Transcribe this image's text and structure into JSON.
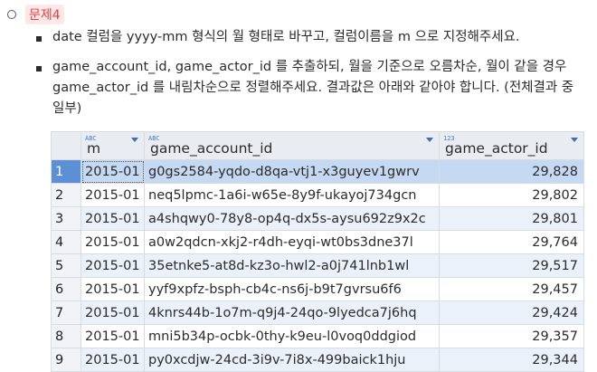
{
  "heading": {
    "badge": "문제4"
  },
  "bullets": [
    "date 컬럼을 yyyy-mm 형식의 월 형태로 바꾸고, 컬럼이름을 m 으로 지정해주세요.",
    "game_account_id, game_actor_id  를 추출하되, 월을 기준으로 오름차순, 월이 같을 경우 game_actor_id 를 내림차순으로 정렬해주세요. 결과값은 아래와 같아야 합니다. (전체결과 중 일부)"
  ],
  "grid": {
    "columns": [
      {
        "label": "m",
        "type_icon": "ABC"
      },
      {
        "label": "game_account_id",
        "type_icon": "ABC"
      },
      {
        "label": "game_actor_id",
        "type_icon": "123"
      }
    ],
    "rows": [
      {
        "num": "1",
        "m": "2015-01",
        "account": "g0gs2584-yqdo-d8qa-vtj1-x3guyev1gwrv",
        "actor": "29,828"
      },
      {
        "num": "2",
        "m": "2015-01",
        "account": "neq5lpmc-1a6i-w65e-8y9f-ukayoj734gcn",
        "actor": "29,802"
      },
      {
        "num": "3",
        "m": "2015-01",
        "account": "a4shqwy0-78y8-op4q-dx5s-aysu692z9x2c",
        "actor": "29,801"
      },
      {
        "num": "4",
        "m": "2015-01",
        "account": "a0w2qdcn-xkj2-r4dh-eyqi-wt0bs3dne37l",
        "actor": "29,764"
      },
      {
        "num": "5",
        "m": "2015-01",
        "account": "35etnke5-at8d-kz3o-hwl2-a0j741lnb1wl",
        "actor": "29,517"
      },
      {
        "num": "6",
        "m": "2015-01",
        "account": "yyf9xpfz-bsph-cb4c-ns6j-b9t7gvrsu6f6",
        "actor": "29,457"
      },
      {
        "num": "7",
        "m": "2015-01",
        "account": "4knrs44b-1o7m-q9j4-24qo-9lyedca7j6hq",
        "actor": "29,424"
      },
      {
        "num": "8",
        "m": "2015-01",
        "account": "mni5b34p-ocbk-0thy-k9eu-l0voq0ddgiod",
        "actor": "29,357"
      },
      {
        "num": "9",
        "m": "2015-01",
        "account": "py0xcdjw-24cd-3i9v-7i8x-499baick1hju",
        "actor": "29,344"
      }
    ]
  }
}
